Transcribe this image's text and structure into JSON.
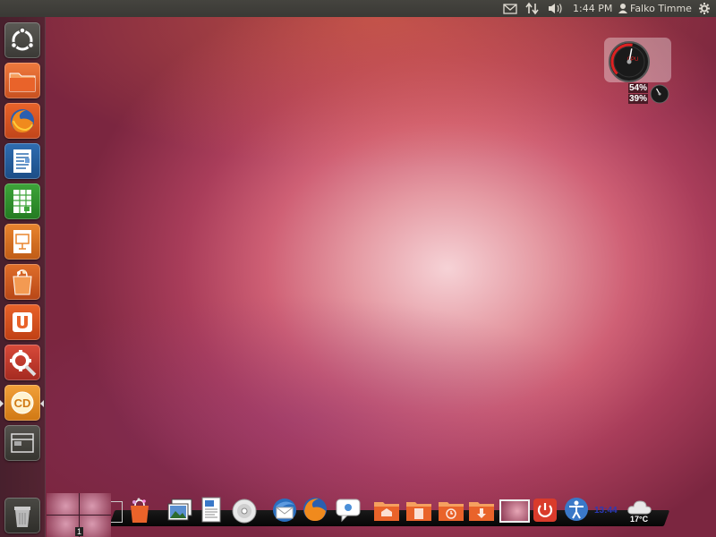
{
  "panel": {
    "time": "1:44 PM",
    "user": "Falko Timme",
    "icons": [
      "mail-icon",
      "network-icon",
      "volume-icon",
      "user-icon",
      "gear-icon"
    ]
  },
  "launcher": {
    "items": [
      {
        "name": "dash-home",
        "icon": "ubuntu-logo-icon"
      },
      {
        "name": "home-folder",
        "icon": "folder-icon"
      },
      {
        "name": "firefox",
        "icon": "firefox-icon"
      },
      {
        "name": "libreoffice-writer",
        "icon": "writer-icon"
      },
      {
        "name": "libreoffice-calc",
        "icon": "calc-icon"
      },
      {
        "name": "libreoffice-impress",
        "icon": "impress-icon"
      },
      {
        "name": "software-center",
        "icon": "shopping-bag-icon"
      },
      {
        "name": "ubuntu-one",
        "icon": "ubuntu-one-icon"
      },
      {
        "name": "system-settings",
        "icon": "settings-icon"
      },
      {
        "name": "cairo-dock",
        "icon": "cairo-dock-icon"
      },
      {
        "name": "workspace-switcher",
        "icon": "workspace-icon"
      },
      {
        "name": "trash",
        "icon": "trash-icon"
      }
    ]
  },
  "cpu_widget": {
    "cpu_label": "CPU",
    "cpu_percent": "54%",
    "mem_percent": "39%",
    "cpu_level": 0.54,
    "mem_level": 0.39
  },
  "dock": {
    "workspace_number": "1",
    "clock": "13:44",
    "weather_temp": "17°C",
    "items": [
      "workspace-preview",
      "software-center",
      "image-viewer",
      "document-viewer",
      "cd-burner",
      "thunderbird",
      "firefox",
      "pidgin",
      "home-folder",
      "documents-folder",
      "recent-folder",
      "downloads-folder",
      "desktop-preview",
      "shutdown",
      "accessibility",
      "clock",
      "weather"
    ]
  },
  "colors": {
    "panel_bg": "#3c3b37",
    "accent_orange": "#e9632a",
    "dock_bg": "#0b0b0b"
  }
}
